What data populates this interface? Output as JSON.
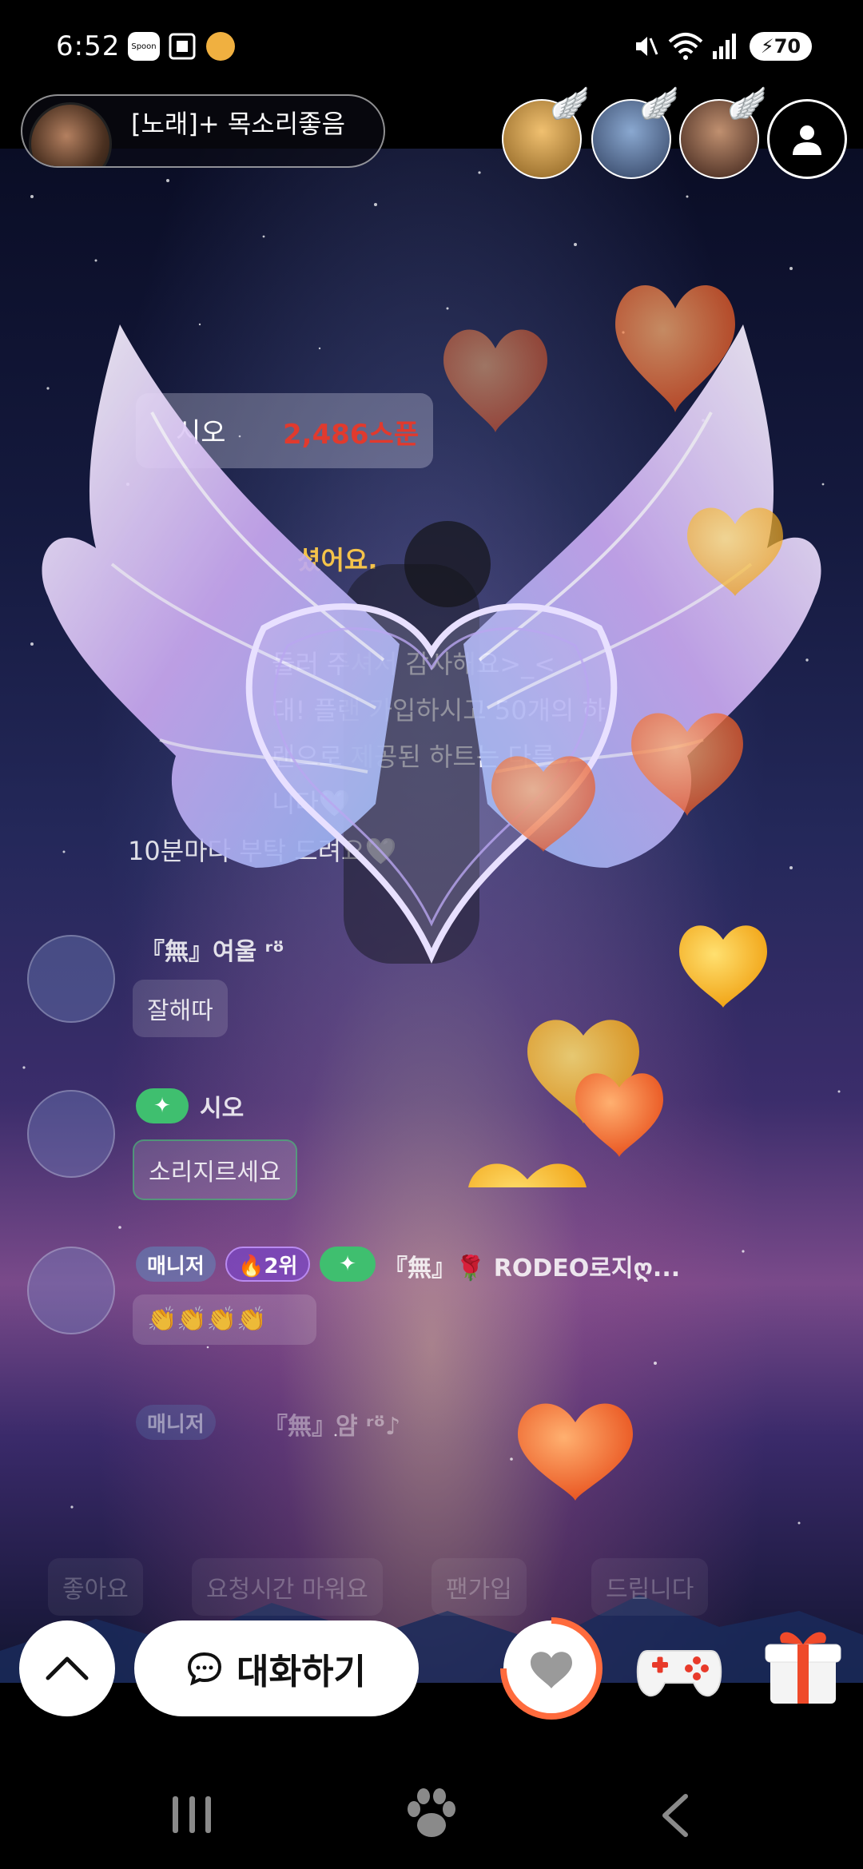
{
  "status_bar": {
    "time": "6:52",
    "battery": "70",
    "app_badge": "Spoon"
  },
  "room": {
    "title": "[노래]+ 목소리좋음"
  },
  "chat": {
    "spoon_prefix": "시오",
    "spoon_amount": "2,486스푼",
    "notice_line1": "셨어요.",
    "notice_line2": "들러 주셔서 감사해요>_<",
    "notice_line3": "대! 플랜 가입하시고 50개의 하",
    "notice_line4": "랜으로 제공된 하트는 다른",
    "notice_line5": "니다🤍",
    "notice_line6": "10분마다 부탁 드려요🤍",
    "messages": [
      {
        "name": "『無』여울 ʳᵒ̈",
        "text": "잘해따"
      },
      {
        "name": "시오",
        "text": "소리지르세요"
      },
      {
        "name": "『無』🌹 RODEO로지ღ...",
        "text": "👏👏👏👏"
      }
    ],
    "badges": {
      "manager": "매니저",
      "rank": "🔥2위",
      "manager2": "매니저"
    },
    "faint_last": "『無』얌 ʳᵒ̈♪",
    "faint_bottom": [
      "좋아요",
      "요청시간 마워요",
      "팬가입",
      "드립니다"
    ]
  },
  "controls": {
    "chat_label": "대화하기"
  },
  "colors": {
    "accent": "#ff6b3d",
    "spoon_red": "#e03a2e",
    "badge_green": "#3fbf6f",
    "badge_purple": "#7a46c8"
  },
  "icons": {
    "up": "chevron-up-icon",
    "chat": "chat-bubble-icon",
    "heart": "heart-icon",
    "game": "gamepad-icon",
    "gift": "gift-icon",
    "profile": "person-icon"
  }
}
